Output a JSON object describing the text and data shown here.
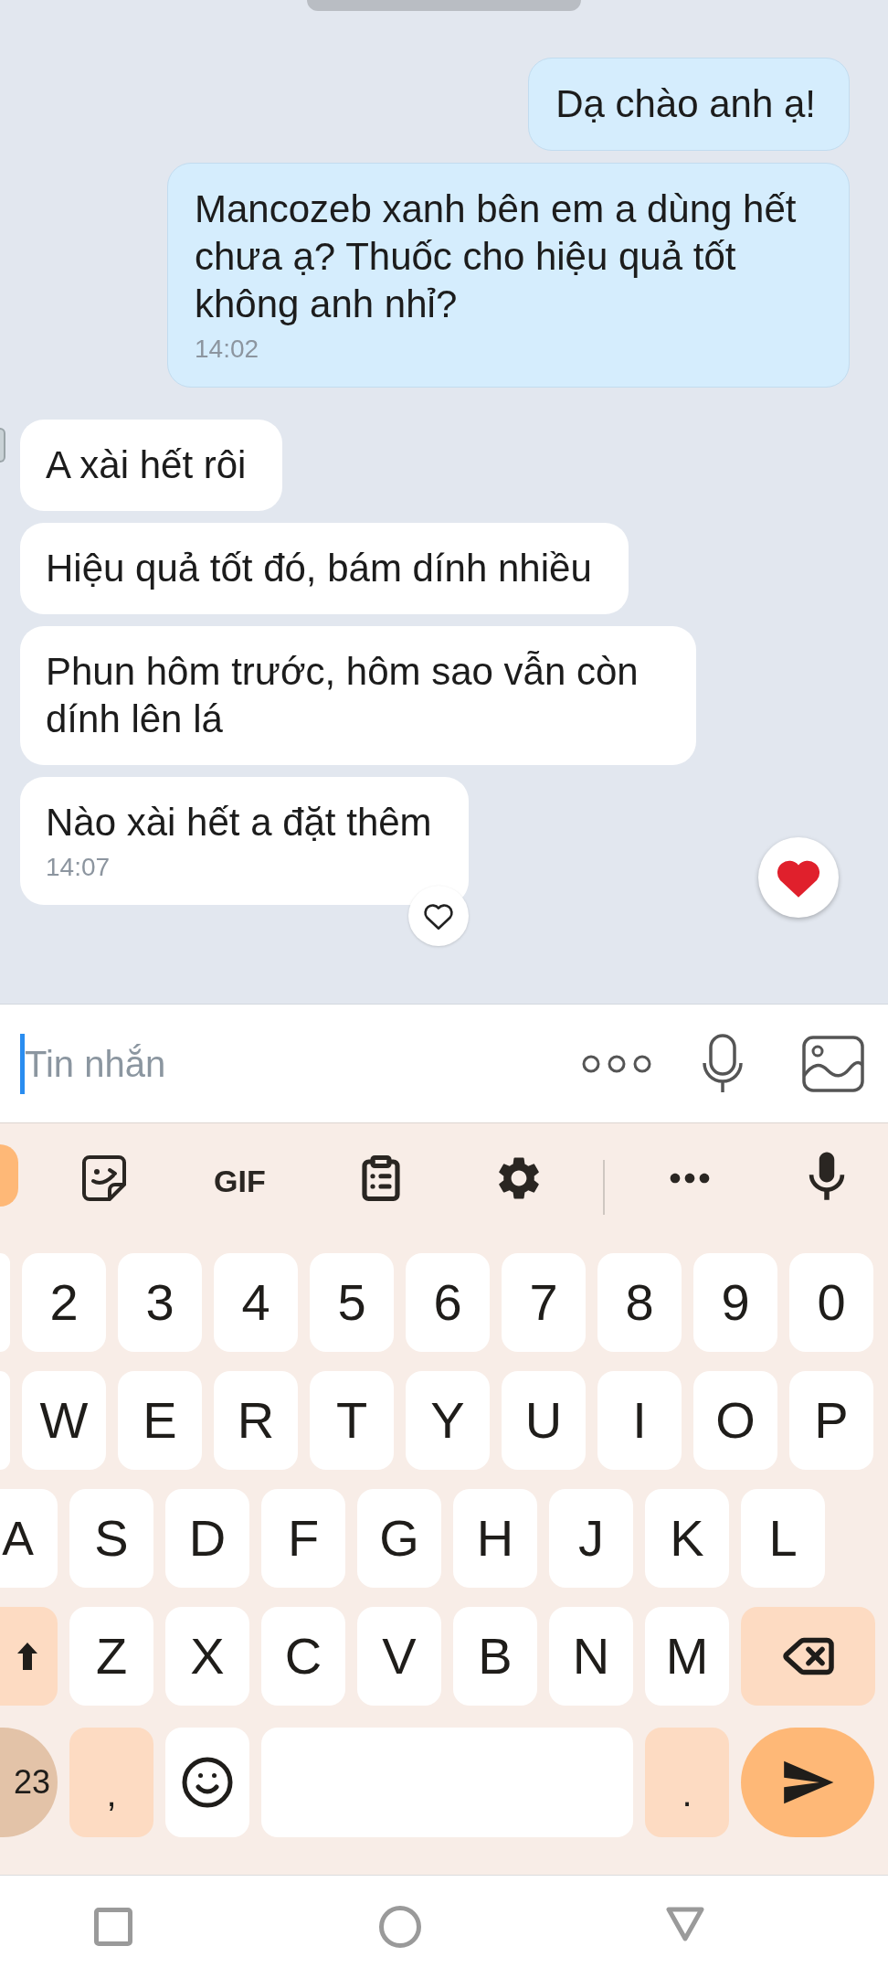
{
  "chat": {
    "messages": [
      {
        "kind": "sent",
        "text": "Dạ chào anh ạ!"
      },
      {
        "kind": "sent",
        "text": "Mancozeb xanh bên em a dùng hết chưa ạ? Thuốc cho hiệu quả tốt không anh nhỉ?",
        "time": "14:02"
      },
      {
        "kind": "received",
        "text": "A xài hết rôi"
      },
      {
        "kind": "received",
        "text": "Hiệu quả tốt đó, bám dính nhiều"
      },
      {
        "kind": "received",
        "text": "Phun hôm trước, hôm sao vẫn còn dính lên lá"
      },
      {
        "kind": "received",
        "text": "Nào xài hết a đặt thêm",
        "time": "14:07"
      }
    ]
  },
  "composer": {
    "placeholder": "Tin nhắn"
  },
  "keyboard": {
    "toolbar": {
      "gif_label": "GIF"
    },
    "rows": [
      [
        {
          "kind": "stub"
        },
        {
          "kind": "char",
          "label": "2"
        },
        {
          "kind": "char",
          "label": "3"
        },
        {
          "kind": "char",
          "label": "4"
        },
        {
          "kind": "char",
          "label": "5"
        },
        {
          "kind": "char",
          "label": "6"
        },
        {
          "kind": "char",
          "label": "7"
        },
        {
          "kind": "char",
          "label": "8"
        },
        {
          "kind": "char",
          "label": "9"
        },
        {
          "kind": "char",
          "label": "0"
        }
      ],
      [
        {
          "kind": "stub"
        },
        {
          "kind": "char",
          "label": "W"
        },
        {
          "kind": "char",
          "label": "E"
        },
        {
          "kind": "char",
          "label": "R"
        },
        {
          "kind": "char",
          "label": "T"
        },
        {
          "kind": "char",
          "label": "Y"
        },
        {
          "kind": "char",
          "label": "U"
        },
        {
          "kind": "char",
          "label": "I"
        },
        {
          "kind": "char",
          "label": "O"
        },
        {
          "kind": "char",
          "label": "P"
        }
      ],
      [
        {
          "kind": "partial",
          "label": "A"
        },
        {
          "kind": "char",
          "label": "S"
        },
        {
          "kind": "char",
          "label": "D"
        },
        {
          "kind": "char",
          "label": "F"
        },
        {
          "kind": "char",
          "label": "G"
        },
        {
          "kind": "char",
          "label": "H"
        },
        {
          "kind": "char",
          "label": "J"
        },
        {
          "kind": "char",
          "label": "K"
        },
        {
          "kind": "char",
          "label": "L"
        }
      ],
      [
        {
          "kind": "shift"
        },
        {
          "kind": "char",
          "label": "Z"
        },
        {
          "kind": "char",
          "label": "X"
        },
        {
          "kind": "char",
          "label": "C"
        },
        {
          "kind": "char",
          "label": "V"
        },
        {
          "kind": "char",
          "label": "B"
        },
        {
          "kind": "char",
          "label": "N"
        },
        {
          "kind": "char",
          "label": "M"
        },
        {
          "kind": "backspace"
        }
      ],
      [
        {
          "kind": "symbols",
          "label": "23"
        },
        {
          "kind": "punct",
          "label": ","
        },
        {
          "kind": "emoji"
        },
        {
          "kind": "space"
        },
        {
          "kind": "punct",
          "label": "."
        },
        {
          "kind": "send"
        }
      ]
    ]
  }
}
